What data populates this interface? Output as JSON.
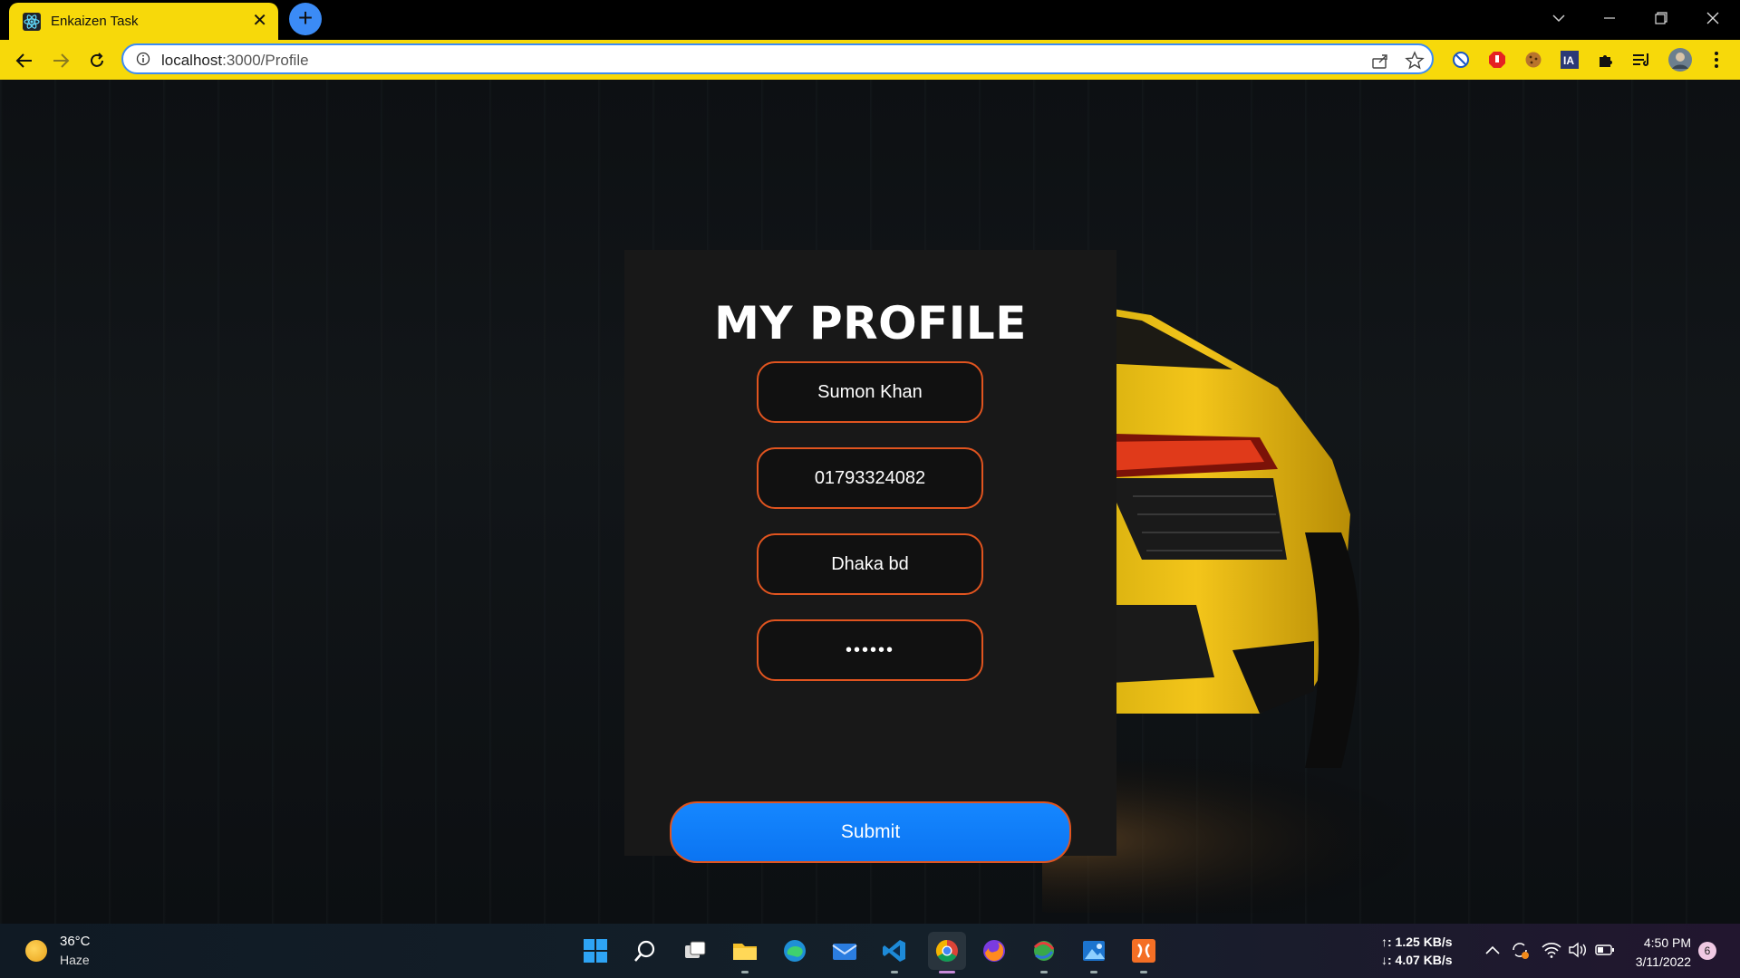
{
  "browser": {
    "tab_title": "Enkaizen Task",
    "close_glyph": "✕",
    "new_tab_glyph": "+",
    "url_host": "localhost",
    "url_path": ":3000/Profile",
    "accent_color": "#f7d90a"
  },
  "profile_form": {
    "heading": "MY PROFILE",
    "name_value": "Sumon Khan",
    "phone_value": "01793324082",
    "address_value": "Dhaka bd",
    "password_value": "••••••",
    "submit_label": "Submit",
    "field_border_color": "#e0541f",
    "button_color": "#1587ff"
  },
  "taskbar": {
    "temperature": "36°C",
    "weather": "Haze",
    "upload_speed": "↑: 1.25 KB/s",
    "download_speed": "↓: 4.07 KB/s",
    "time": "4:50 PM",
    "date": "3/11/2022",
    "notification_count": "6"
  }
}
